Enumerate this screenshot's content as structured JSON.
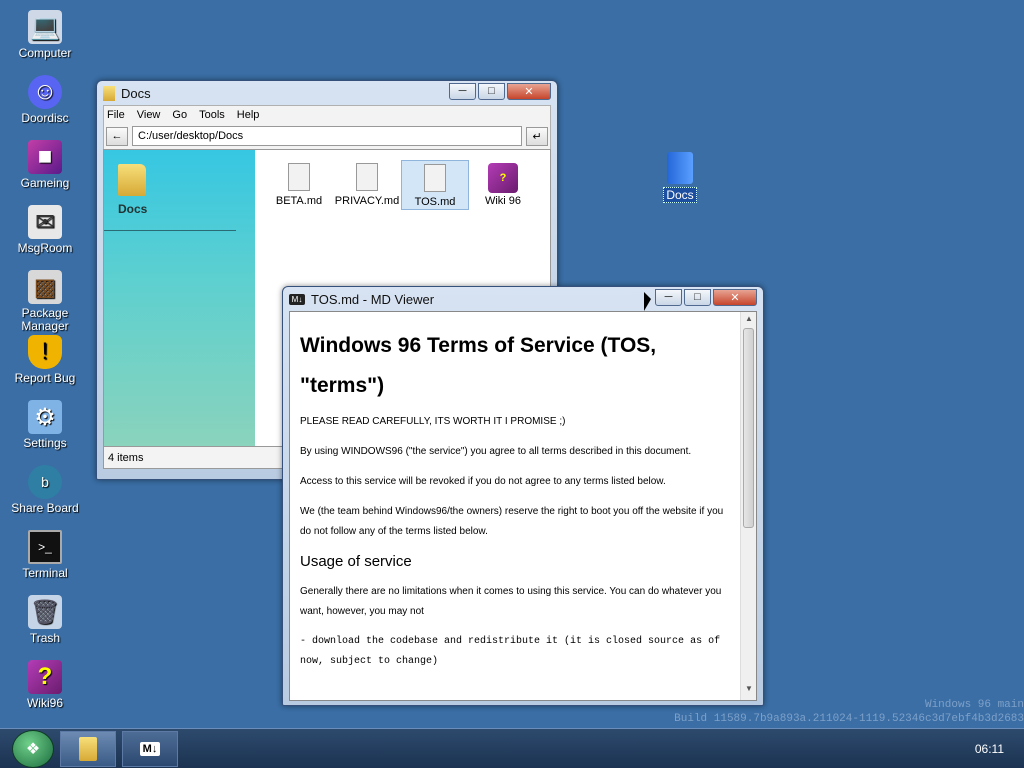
{
  "desktop": {
    "icons": [
      {
        "label": "Computer",
        "icon": "computer-icon"
      },
      {
        "label": "Doordisc",
        "icon": "discord-icon"
      },
      {
        "label": "Gameing",
        "icon": "cube-icon"
      },
      {
        "label": "MsgRoom",
        "icon": "chat-icon"
      },
      {
        "label": "Package Manager",
        "icon": "package-icon"
      },
      {
        "label": "Report Bug",
        "icon": "shield-icon"
      },
      {
        "label": "Settings",
        "icon": "settings-icon"
      },
      {
        "label": "Share Board",
        "icon": "share-icon"
      },
      {
        "label": "Terminal",
        "icon": "terminal-icon"
      },
      {
        "label": "Trash",
        "icon": "trash-icon"
      },
      {
        "label": "Wiki96",
        "icon": "book-icon"
      }
    ],
    "docs_icon_label": "Docs"
  },
  "explorer": {
    "title": "Docs",
    "menu": [
      "File",
      "View",
      "Go",
      "Tools",
      "Help"
    ],
    "address": "C:/user/desktop/Docs",
    "sidebar_label": "Docs",
    "files": [
      {
        "name": "BETA.md",
        "icon": "file-icon"
      },
      {
        "name": "PRIVACY.md",
        "icon": "file-icon"
      },
      {
        "name": "TOS.md",
        "icon": "file-icon"
      },
      {
        "name": "Wiki 96",
        "icon": "book-icon"
      }
    ],
    "status": "4 items"
  },
  "viewer": {
    "title": "TOS.md - MD Viewer",
    "heading": "Windows 96 Terms of Service (TOS, \"terms\")",
    "p1": "PLEASE READ CAREFULLY, ITS WORTH IT I PROMISE ;)",
    "p2": "By using WINDOWS96 (\"the service\") you agree to all terms described in this document.",
    "p3": "Access to this service will be revoked if you do not agree to any terms listed below.",
    "p4": "We (the team behind Windows96/the owners) reserve the right to boot you off the website if you do not follow any of the terms listed below.",
    "h2": "Usage of service",
    "p5": "Generally there are no limitations when it comes to using this service. You can do whatever you want, however, you may not",
    "code": "- download the codebase and redistribute it (it is closed source as of now, subject to change)"
  },
  "watermark": {
    "line1": "Windows 96 main",
    "line2": "Build 11589.7b9a893a.211024-1119.52346c3d7ebf4b3d2683"
  },
  "taskbar": {
    "clock": "06:11"
  }
}
